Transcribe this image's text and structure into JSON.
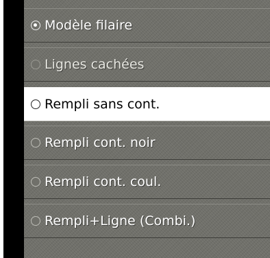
{
  "render_options": [
    {
      "label": "Modèle filaire",
      "selected": true,
      "state": "normal"
    },
    {
      "label": "Lignes cachées",
      "selected": false,
      "state": "dimmed"
    },
    {
      "label": "Rempli sans cont.",
      "selected": false,
      "state": "highlighted"
    },
    {
      "label": "Rempli cont. noir",
      "selected": false,
      "state": "normal"
    },
    {
      "label": "Rempli cont. coul.",
      "selected": false,
      "state": "normal"
    },
    {
      "label": "Rempli+Ligne (Combi.)",
      "selected": false,
      "state": "normal"
    }
  ],
  "colors": {
    "panel_background": "#70706a",
    "highlight_background": "#ffffff",
    "left_bar": "#000000"
  }
}
